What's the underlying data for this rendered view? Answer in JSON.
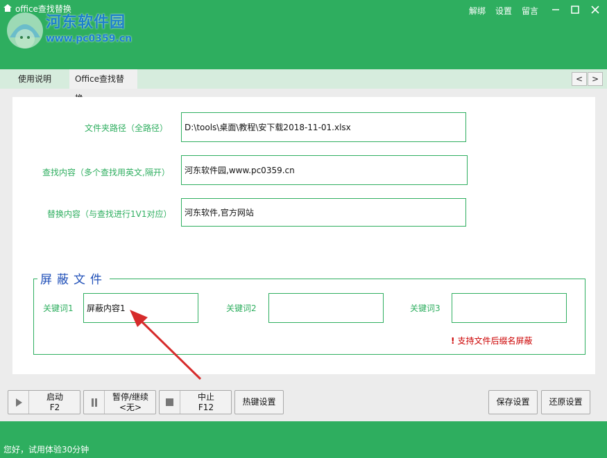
{
  "window": {
    "title": "office查找替换",
    "menu": [
      "解绑",
      "设置",
      "留言"
    ],
    "controls": [
      "minimize",
      "maximize",
      "close"
    ]
  },
  "watermark": {
    "name": "河东软件园",
    "url": "www.pc0359.cn"
  },
  "tabs": [
    {
      "label": "使用说明",
      "active": false
    },
    {
      "label": "Office查找替换",
      "active": true
    }
  ],
  "tab_nav": {
    "prev": "<",
    "next": ">"
  },
  "form": {
    "folder_label": "文件夹路径（全路径）",
    "folder_value": "D:\\tools\\桌面\\教程\\安下载2018-11-01.xlsx",
    "find_label": "查找内容（多个查找用英文,隔开）",
    "find_value": "河东软件园,www.pc0359.cn",
    "replace_label": "替换内容（与查找进行1V1对应）",
    "replace_value": "河东软件,官方网站"
  },
  "shield": {
    "title": "屏蔽文件",
    "keyword1_label": "关键词1",
    "keyword1_value": "屏蔽内容1",
    "keyword2_label": "关键词2",
    "keyword2_value": "",
    "keyword3_label": "关键词3",
    "keyword3_value": "",
    "warning": "支持文件后缀名屏蔽",
    "warning_mark": "!"
  },
  "buttons": {
    "start": {
      "label": "启动",
      "hotkey": "F2"
    },
    "pause": {
      "label": "暂停/继续",
      "hotkey": "<无>"
    },
    "stop": {
      "label": "中止",
      "hotkey": "F12"
    },
    "hotkey_settings": "热键设置",
    "save_settings": "保存设置",
    "restore_settings": "还原设置"
  },
  "status": "您好，试用体验30分钟",
  "colors": {
    "accent": "#2eae5f",
    "arrow": "#d62b2b",
    "group_title": "#1f4fb8",
    "warning": "#cc0000"
  }
}
